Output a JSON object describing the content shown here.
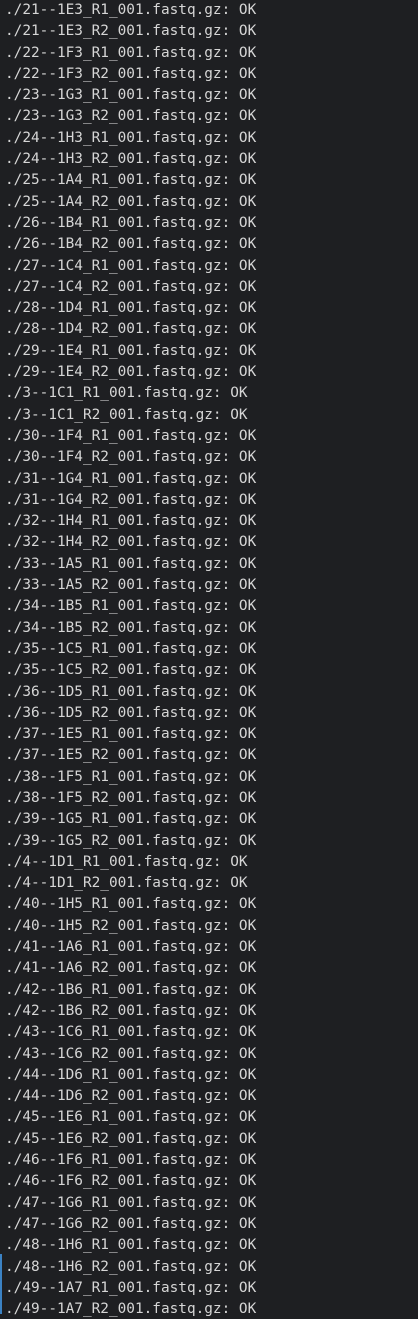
{
  "terminal": {
    "lines": [
      "./21--1E3_R1_001.fastq.gz: OK",
      "./21--1E3_R2_001.fastq.gz: OK",
      "./22--1F3_R1_001.fastq.gz: OK",
      "./22--1F3_R2_001.fastq.gz: OK",
      "./23--1G3_R1_001.fastq.gz: OK",
      "./23--1G3_R2_001.fastq.gz: OK",
      "./24--1H3_R1_001.fastq.gz: OK",
      "./24--1H3_R2_001.fastq.gz: OK",
      "./25--1A4_R1_001.fastq.gz: OK",
      "./25--1A4_R2_001.fastq.gz: OK",
      "./26--1B4_R1_001.fastq.gz: OK",
      "./26--1B4_R2_001.fastq.gz: OK",
      "./27--1C4_R1_001.fastq.gz: OK",
      "./27--1C4_R2_001.fastq.gz: OK",
      "./28--1D4_R1_001.fastq.gz: OK",
      "./28--1D4_R2_001.fastq.gz: OK",
      "./29--1E4_R1_001.fastq.gz: OK",
      "./29--1E4_R2_001.fastq.gz: OK",
      "./3--1C1_R1_001.fastq.gz: OK",
      "./3--1C1_R2_001.fastq.gz: OK",
      "./30--1F4_R1_001.fastq.gz: OK",
      "./30--1F4_R2_001.fastq.gz: OK",
      "./31--1G4_R1_001.fastq.gz: OK",
      "./31--1G4_R2_001.fastq.gz: OK",
      "./32--1H4_R1_001.fastq.gz: OK",
      "./32--1H4_R2_001.fastq.gz: OK",
      "./33--1A5_R1_001.fastq.gz: OK",
      "./33--1A5_R2_001.fastq.gz: OK",
      "./34--1B5_R1_001.fastq.gz: OK",
      "./34--1B5_R2_001.fastq.gz: OK",
      "./35--1C5_R1_001.fastq.gz: OK",
      "./35--1C5_R2_001.fastq.gz: OK",
      "./36--1D5_R1_001.fastq.gz: OK",
      "./36--1D5_R2_001.fastq.gz: OK",
      "./37--1E5_R1_001.fastq.gz: OK",
      "./37--1E5_R2_001.fastq.gz: OK",
      "./38--1F5_R1_001.fastq.gz: OK",
      "./38--1F5_R2_001.fastq.gz: OK",
      "./39--1G5_R1_001.fastq.gz: OK",
      "./39--1G5_R2_001.fastq.gz: OK",
      "./4--1D1_R1_001.fastq.gz: OK",
      "./4--1D1_R2_001.fastq.gz: OK",
      "./40--1H5_R1_001.fastq.gz: OK",
      "./40--1H5_R2_001.fastq.gz: OK",
      "./41--1A6_R1_001.fastq.gz: OK",
      "./41--1A6_R2_001.fastq.gz: OK",
      "./42--1B6_R1_001.fastq.gz: OK",
      "./42--1B6_R2_001.fastq.gz: OK",
      "./43--1C6_R1_001.fastq.gz: OK",
      "./43--1C6_R2_001.fastq.gz: OK",
      "./44--1D6_R1_001.fastq.gz: OK",
      "./44--1D6_R2_001.fastq.gz: OK",
      "./45--1E6_R1_001.fastq.gz: OK",
      "./45--1E6_R2_001.fastq.gz: OK",
      "./46--1F6_R1_001.fastq.gz: OK",
      "./46--1F6_R2_001.fastq.gz: OK",
      "./47--1G6_R1_001.fastq.gz: OK",
      "./47--1G6_R2_001.fastq.gz: OK",
      "./48--1H6_R1_001.fastq.gz: OK",
      "./48--1H6_R2_001.fastq.gz: OK",
      "./49--1A7_R1_001.fastq.gz: OK",
      "./49--1A7_R2_001.fastq.gz: OK"
    ]
  },
  "colors": {
    "background": "#1e1f22",
    "text": "#d6d6d6",
    "accent": "#3b82c4"
  }
}
